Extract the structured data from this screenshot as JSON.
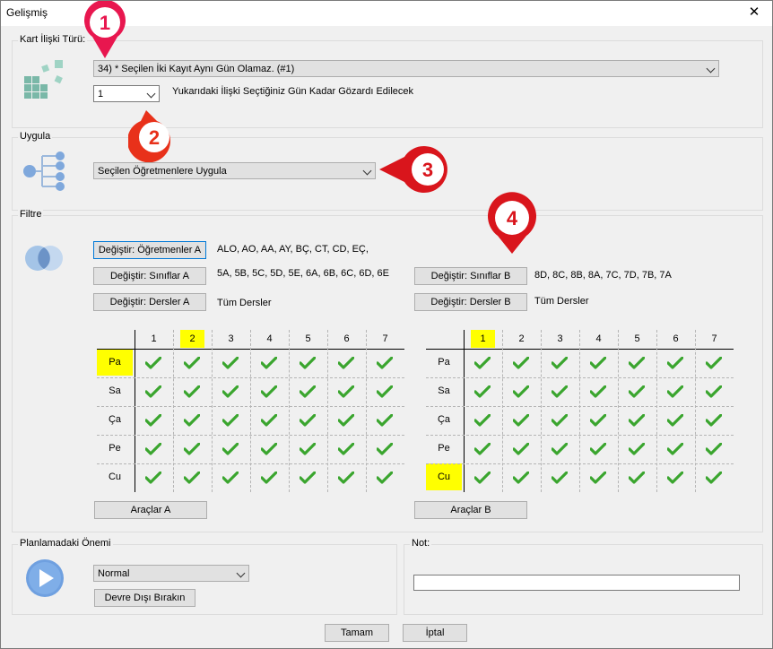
{
  "window": {
    "title": "Gelişmiş",
    "close_glyph": "✕"
  },
  "kart": {
    "label": "Kart İlişki Türü:",
    "relation": "34) * Seçilen İki Kayıt Aynı Gün Olamaz. (#1)",
    "days_value": "1",
    "days_text": "Yukarıdaki İlişki Seçtiğiniz Gün Kadar Gözardı Edilecek"
  },
  "uygula": {
    "label": "Uygula",
    "value": "Seçilen Öğretmenlere Uygula"
  },
  "filtre": {
    "label": "Filtre",
    "btn_ogretmen_a": "Değiştir: Öğretmenler A",
    "ogretmen_a_val": "ALO, AO, AA, AY, BÇ, CT, CD, EÇ,",
    "btn_sinif_a": "Değiştir: Sınıflar A",
    "sinif_a_val": "5A, 5B, 5C, 5D, 5E, 6A, 6B, 6C, 6D, 6E",
    "btn_ders_a": "Değiştir: Dersler A",
    "ders_a_val": "Tüm Dersler",
    "btn_sinif_b": "Değiştir: Sınıflar B",
    "sinif_b_val": "8D, 8C, 8B, 8A, 7C, 7D, 7B, 7A",
    "btn_ders_b": "Değiştir: Dersler B",
    "ders_b_val": "Tüm Dersler",
    "btn_araclar_a": "Araçlar A",
    "btn_araclar_b": "Araçlar B",
    "periods": [
      "1",
      "2",
      "3",
      "4",
      "5",
      "6",
      "7"
    ],
    "days": [
      "Pa",
      "Sa",
      "Ça",
      "Pe",
      "Cu"
    ],
    "grid_a_highlight_period": 2,
    "grid_a_highlight_day": "Pa",
    "grid_b_highlight_period": 1,
    "grid_b_highlight_day": "Cu"
  },
  "onem": {
    "label": "Planlamadaki Önemi",
    "value": "Normal",
    "btn_disable": "Devre Dışı Bırakın"
  },
  "not": {
    "label": "Not:",
    "value": ""
  },
  "footer": {
    "ok": "Tamam",
    "cancel": "İptal"
  },
  "annotations": [
    "1",
    "2",
    "3",
    "4"
  ],
  "colors": {
    "pin1": "#e8174f",
    "pin2": "#e8311a",
    "pin3": "#d9151c",
    "pin4": "#d9151c",
    "check": "#3aa52e",
    "highlight": "#ffff00"
  }
}
